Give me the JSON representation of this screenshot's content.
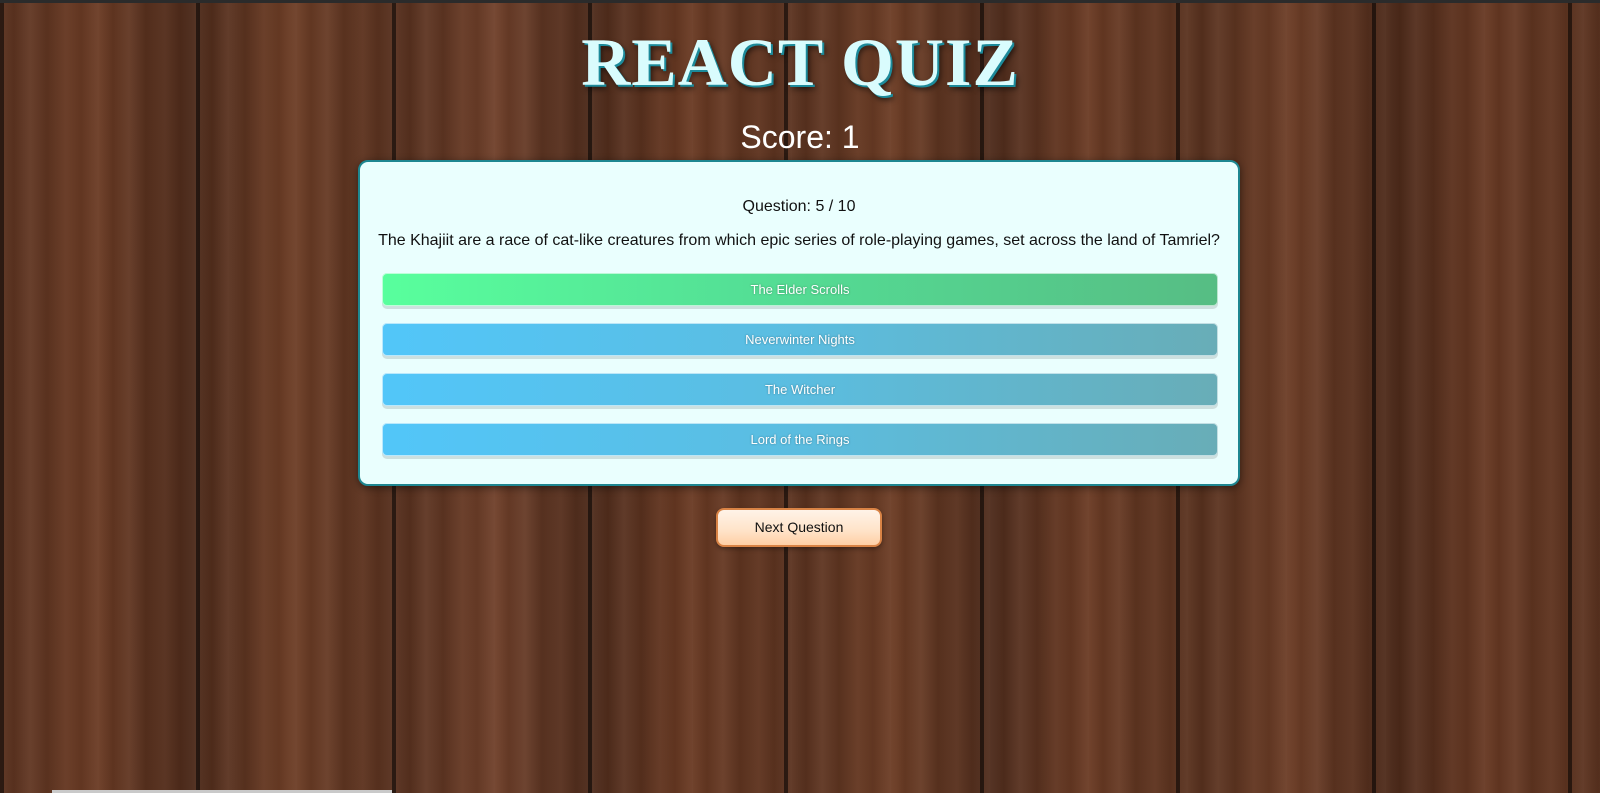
{
  "app": {
    "title": "REACT QUIZ",
    "score_text": "Score: 1"
  },
  "quiz": {
    "question_count_text": "Question: 5 / 10",
    "question_text": "The Khajiit are a race of cat-like creatures from which epic series of role-playing games, set across the land of Tamriel?",
    "answers": [
      {
        "label": "The Elder Scrolls",
        "state": "correct"
      },
      {
        "label": "Neverwinter Nights",
        "state": "neutral"
      },
      {
        "label": "The Witcher",
        "state": "neutral"
      },
      {
        "label": "Lord of the Rings",
        "state": "neutral"
      }
    ],
    "next_button_label": "Next Question"
  },
  "colors": {
    "title_text": "#d9fcfd",
    "card_background": "#eafffe",
    "card_border": "#1e8791",
    "correct_answer": "#54de95",
    "neutral_answer": "#5bbde0",
    "next_button": "#ffe3c8"
  }
}
